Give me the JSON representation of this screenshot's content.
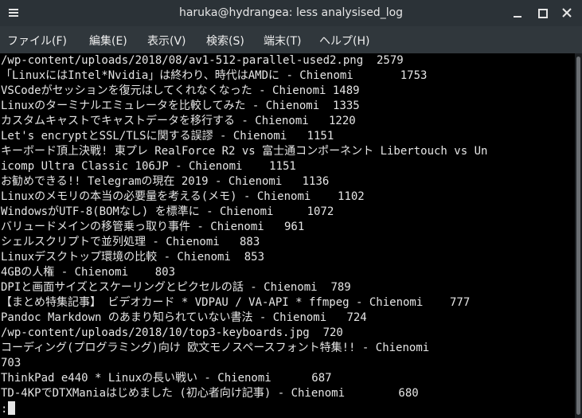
{
  "window": {
    "title": "haruka@hydrangea: less analysised_log",
    "icons": {
      "menu": "hamburger-icon",
      "minimize": "minimize-icon",
      "maximize": "maximize-icon",
      "close": "close-icon"
    }
  },
  "menubar": {
    "items": [
      "ファイル(F)",
      "編集(E)",
      "表示(V)",
      "検索(S)",
      "端末(T)",
      "ヘルプ(H)"
    ]
  },
  "terminal": {
    "lines": [
      "/wp-content/uploads/2018/08/av1-512-parallel-used2.png  2579",
      "「LinuxにはIntel*Nvidia」は終わり、時代はAMDに - Chienomi       1753",
      "VSCodeがセッションを復元はしてくれなくなった - Chienomi 1489",
      "Linuxのターミナルエミュレータを比較してみた - Chienomi  1335",
      "カスタムキャストでキャストデータを移行する - Chienomi   1220",
      "Let's encryptとSSL/TLSに関する誤謬 - Chienomi   1151",
      "キーボード頂上決戦! 東プレ RealForce R2 vs 富士通コンポーネント Libertouch vs Un",
      "icomp Ultra Classic 106JP - Chienomi    1151",
      "お勧めできる!! Telegramの現在 2019 - Chienomi   1136",
      "Linuxのメモリの本当の必要量を考える(メモ) - Chienomi    1102",
      "WindowsがUTF-8(BOMなし) を標準に - Chienomi     1072",
      "バリュードメインの移管乗っ取り事件 - Chienomi   961",
      "シェルスクリプトで並列処理 - Chienomi   883",
      "Linuxデスクトップ環境の比較 - Chienomi  853",
      "4GBの人権 - Chienomi    803",
      "DPIと画面サイズとスケーリングとピクセルの話 - Chienomi  789",
      "【まとめ特集記事】 ビデオカード * VDPAU / VA-API * ffmpeg - Chienomi    777",
      "Pandoc Markdown のあまり知られていない書法 - Chienomi   724",
      "/wp-content/uploads/2018/10/top3-keyboards.jpg  720",
      "コーディング(プログラミング)向け 欧文モノスペースフォント特集!! - Chienomi",
      "703",
      "ThinkPad e440 * Linuxの長い戦い - Chienomi      687",
      "TD-4KPでDTXManiaはじめました (初心者向け記事) - Chienomi        680"
    ],
    "prompt": ":"
  }
}
